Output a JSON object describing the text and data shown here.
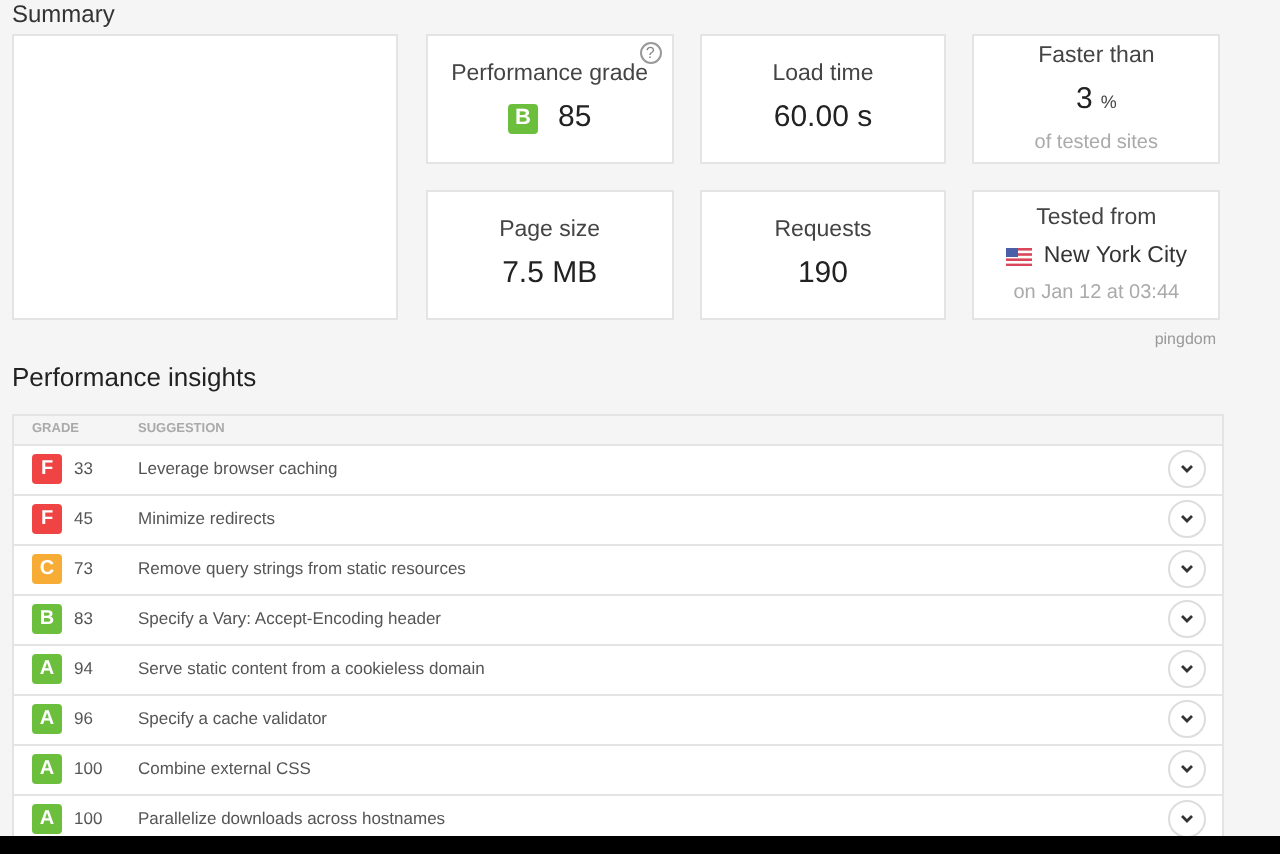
{
  "summary": {
    "title": "Summary",
    "performance": {
      "label": "Performance grade",
      "grade": "B",
      "color": "#6cbf3c",
      "score": "85",
      "help": "?"
    },
    "load_time": {
      "label": "Load time",
      "value": "60.00 s"
    },
    "faster_than": {
      "label": "Faster than",
      "value": "3",
      "unit": "%",
      "note": "of tested sites"
    },
    "page_size": {
      "label": "Page size",
      "value": "7.5 MB"
    },
    "requests": {
      "label": "Requests",
      "value": "190"
    },
    "tested_from": {
      "label": "Tested from",
      "location": "New York City",
      "date": "on Jan 12 at 03:44"
    },
    "brand": "pingdom"
  },
  "insights": {
    "title": "Performance insights",
    "columns": [
      "GRADE",
      "SUGGESTION"
    ],
    "rows": [
      {
        "grade": "F",
        "color": "#f04343",
        "score": "33",
        "suggestion": "Leverage browser caching",
        "expanded": false
      },
      {
        "grade": "F",
        "color": "#f04343",
        "score": "45",
        "suggestion": "Minimize redirects",
        "expanded": false
      },
      {
        "grade": "C",
        "color": "#f7ad35",
        "score": "73",
        "suggestion": "Remove query strings from static resources",
        "expanded": false
      },
      {
        "grade": "B",
        "color": "#6cbf3c",
        "score": "83",
        "suggestion": "Specify a Vary: Accept-Encoding header",
        "expanded": false
      },
      {
        "grade": "A",
        "color": "#6cbf3c",
        "score": "94",
        "suggestion": "Serve static content from a cookieless domain",
        "expanded": false
      },
      {
        "grade": "A",
        "color": "#6cbf3c",
        "score": "96",
        "suggestion": "Specify a cache validator",
        "expanded": false
      },
      {
        "grade": "A",
        "color": "#6cbf3c",
        "score": "100",
        "suggestion": "Combine external CSS",
        "expanded": false
      },
      {
        "grade": "A",
        "color": "#6cbf3c",
        "score": "100",
        "suggestion": "Parallelize downloads across hostnames",
        "expanded": false
      }
    ]
  }
}
